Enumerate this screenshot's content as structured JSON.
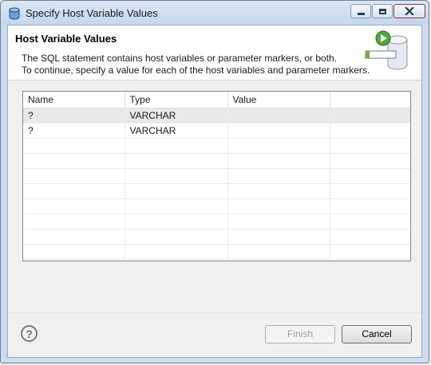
{
  "window": {
    "title": "Specify Host Variable Values"
  },
  "header": {
    "title": "Host Variable Values",
    "message_line1": "The SQL statement contains host variables or parameter markers, or both.",
    "message_line2": "To continue, specify a value for each of the host variables and parameter markers."
  },
  "table": {
    "columns": [
      "Name",
      "Type",
      "Value"
    ],
    "rows": [
      {
        "name": "?",
        "type": "VARCHAR",
        "value": ""
      },
      {
        "name": "?",
        "type": "VARCHAR",
        "value": ""
      }
    ]
  },
  "buttons": {
    "help": "?",
    "finish": "Finish",
    "cancel": "Cancel"
  },
  "colors": {
    "selected_row": "#e8e8e8",
    "title_bar": "#c4d6ee"
  }
}
